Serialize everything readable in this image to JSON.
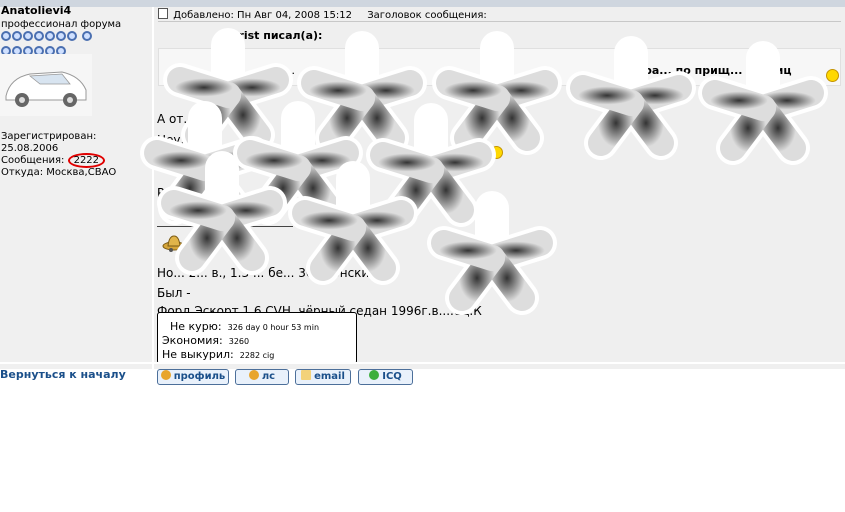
{
  "user": {
    "name": "Anatolievi4",
    "rank": "профессионал форума",
    "registered_label": "Зарегистрирован:",
    "registered_date": "25.08.2006",
    "posts_label": "Сообщения:",
    "posts_count": "2222",
    "from": "Откуда: Москва,СВАО"
  },
  "post": {
    "added": "Добавлено: Пн Авг 04, 2008 15:12",
    "subject_label": "Заголовок сообщения:",
    "quote_author": "arist писал(а):",
    "quote_text_visible": "л ... ...",
    "quote_text_bold": "вра... по прищ... ию яиц",
    "lines": [
      "А от...",
      "Неу... он...",
      "",
      "Р...",
      "",
      "Но... 2... в., 1.3 ... бе... 36 японски...",
      "Был -",
      "Форд Эскорт 1.6,CVH, чёрный,седан 1996г.в....ец.К"
    ]
  },
  "smoke_box": {
    "row1_label": "Не курю:",
    "row1_value": "326 day 0 hour 53 min",
    "row2_label": "Экономия:",
    "row2_value": "3260",
    "row3_label": "Не выкурил:",
    "row3_value": "2282 cig"
  },
  "nav": {
    "back_to_top": "Вернуться к началу"
  },
  "buttons": {
    "profile": "профиль",
    "pm": "лс",
    "email": "email",
    "icq": "ICQ"
  }
}
